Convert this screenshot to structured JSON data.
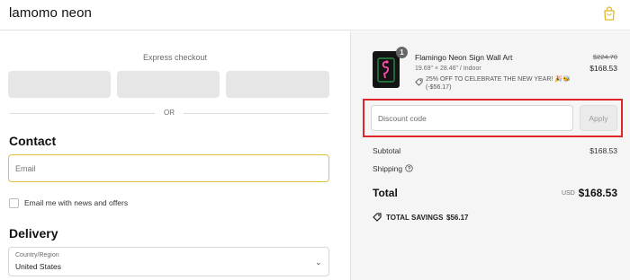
{
  "header": {
    "brand": "lamomo neon",
    "cart_icon": "shopping-bag-icon",
    "accent_color": "#e3b82b"
  },
  "checkout": {
    "express_label": "Express checkout",
    "or_label": "OR",
    "contact": {
      "title": "Contact",
      "email_placeholder": "Email",
      "newsletter_label": "Email me with news and offers",
      "newsletter_checked": false
    },
    "delivery": {
      "title": "Delivery",
      "country_caption": "Country/Region",
      "country_value": "United States"
    }
  },
  "summary": {
    "item": {
      "name": "Flamingo Neon Sign Wall Art",
      "variant": "19.69\" × 28.46\" / Indoor",
      "discount_text": "25% OFF TO CELEBRATE THE NEW YEAR! 🎉🐝",
      "discount_amount": "(-$56.17)",
      "original_price": "$224.70",
      "price": "$168.53",
      "quantity": "1"
    },
    "discount_placeholder": "Discount code",
    "apply_label": "Apply",
    "subtotal_label": "Subtotal",
    "subtotal_value": "$168.53",
    "shipping_label": "Shipping",
    "total_label": "Total",
    "total_currency": "USD",
    "total_value": "$168.53",
    "savings_label": "TOTAL SAVINGS",
    "savings_value": "$56.17",
    "highlight_color": "#e0262b"
  }
}
